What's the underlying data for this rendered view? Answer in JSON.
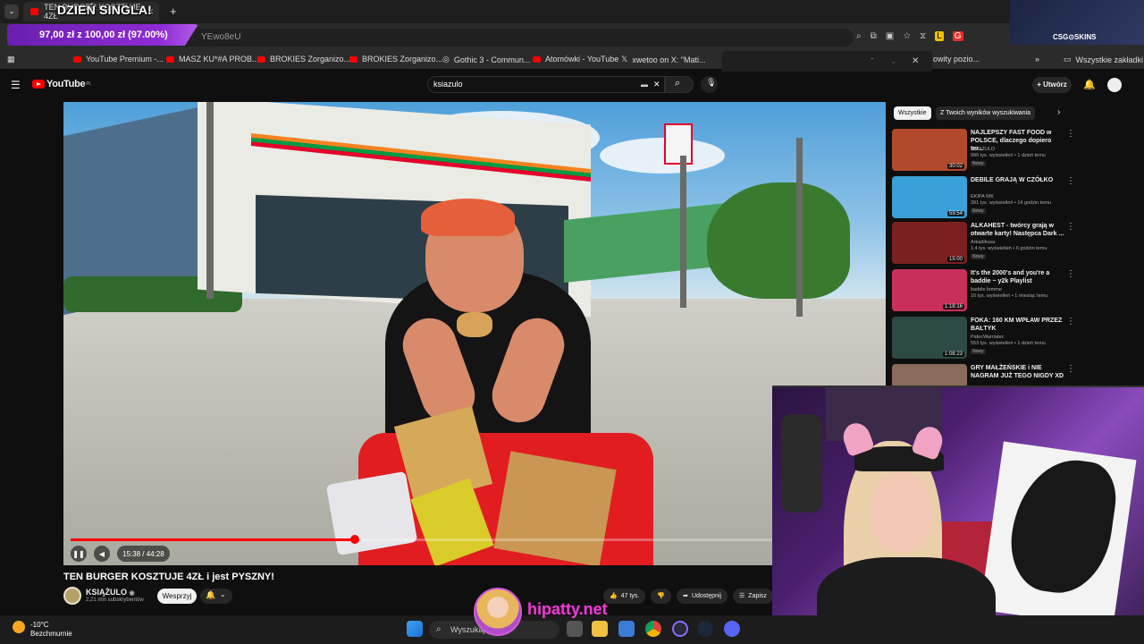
{
  "browser": {
    "tab_title": "TEN BURGER KOSZTUJE 4ZŁ",
    "stream_overlay_title": "DZIEŃ SINGLA!",
    "address_partial": "YEwo8eU",
    "goal_text": "97,00 zł z 100,00 zł (97.00%)",
    "goal_progress": 0.97,
    "bookmarks": [
      "YouTube Premium -...",
      "MASZ KU*#A PROB...",
      "BROKIES Zorganizo...",
      "BROKIES Zorganizo...",
      "Gothic 3 - Commun...",
      "Atomówki - YouTube",
      "xwetoo on X: \"Mati...",
      "owity pozio..."
    ],
    "all_bookmarks": "Wszystkie zakładki"
  },
  "youtube": {
    "logo": "YouTube",
    "logo_region": "PL",
    "search_value": "ksiazulo",
    "create_label": "Utwórz"
  },
  "video": {
    "time": "15:38 / 44:28",
    "progress": 0.352,
    "title": "TEN BURGER KOSZTUJE 4ZŁ i jest PYSZNY!",
    "channel": "KSIĄŻULO",
    "subscribers": "2,21 mln subskrybentów",
    "support_label": "Wesprzyj",
    "likes": "47 tys.",
    "share_label": "Udostępnij",
    "save_label": "Zapisz"
  },
  "sidebar": {
    "chips": [
      "Wszystkie",
      "Z Twoich wyników wyszukiwania"
    ],
    "recs": [
      {
        "title": "NAJLEPSZY FAST FOOD w POLSCE, dlaczego dopiero ter...",
        "channel": "KSIĄŻULO",
        "meta": "996 tys. wyświetleń • 1 dzień temu",
        "badge": "Nowy",
        "duration": "30:02",
        "color": "#b04a2a"
      },
      {
        "title": "DEBILE GRAJĄ W CZÓŁKO",
        "channel": "EKIPA WK",
        "meta": "391 tys. wyświetleń • 14 godzin temu",
        "badge": "Nowy",
        "duration": "59:54",
        "color": "#3aa0d8"
      },
      {
        "title": "ALKAHEST - twórcy grają w otwarte karty! Następca Dark ...",
        "channel": "Arkadikusa",
        "meta": "1,4 tys. wyświetleń • 6 godzin temu",
        "badge": "Nowy",
        "duration": "15:00",
        "color": "#7a2020"
      },
      {
        "title": "It's the 2000's and you're a baddie ~ y2k Playlist",
        "channel": "baddie femme",
        "meta": "16 tys. wyświetleń • 1 miesiąc temu",
        "badge": "",
        "duration": "1:18:16",
        "color": "#c8305a"
      },
      {
        "title": "FOKA: 160 KM WPŁAW PRZEZ BAŁTYK",
        "channel": "PatecWarriatec",
        "meta": "553 tys. wyświetleń • 1 dzień temu",
        "badge": "Nowy",
        "duration": "1:08:23",
        "color": "#2d4a44"
      },
      {
        "title": "GRY MAŁŻEŃSKIE i NIE NAGRAM JUŻ TEGO NIGDY XD",
        "channel": "",
        "meta": "",
        "badge": "",
        "duration": "",
        "color": "#8a6a5a"
      }
    ]
  },
  "overlay": {
    "hipatty": "hipatty.net",
    "csgo": "CSG⊙SKINS"
  },
  "taskbar": {
    "temp": "-10°C",
    "weather": "Bezchmurnie",
    "search_label": "Wyszukaj"
  }
}
